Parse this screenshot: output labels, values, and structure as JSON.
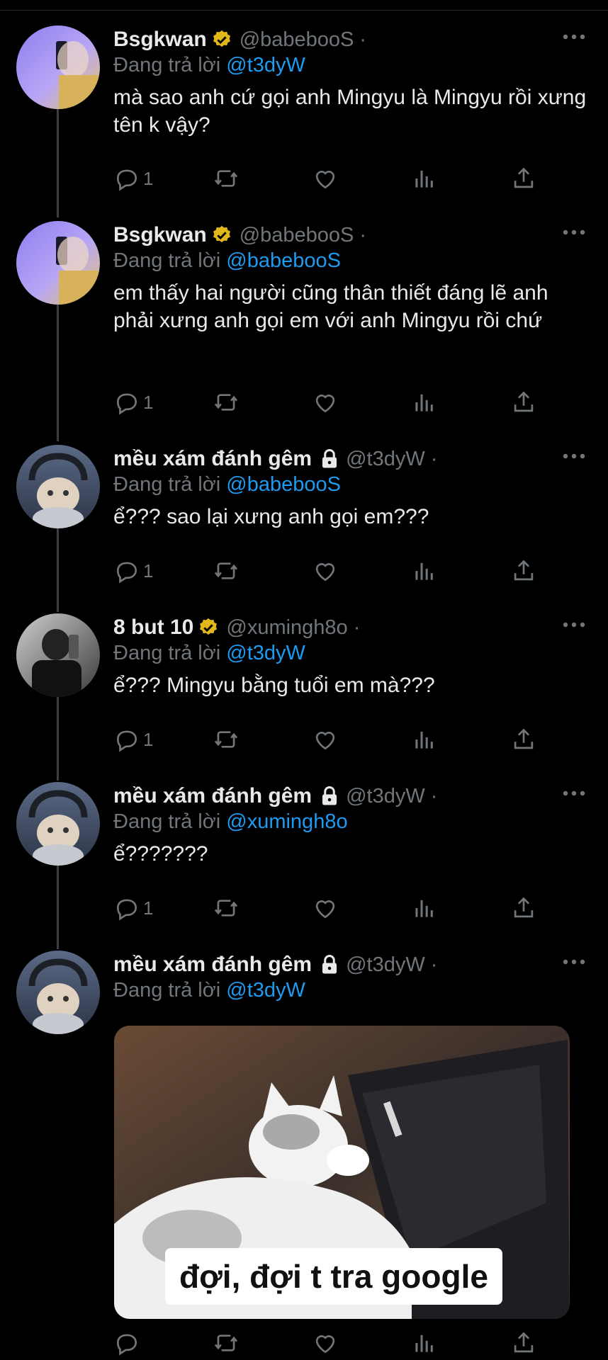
{
  "reply_prefix": "Đang trả lời",
  "tweets": [
    {
      "name": "Bsgkwan",
      "handle": "@babebooS",
      "dot": "·",
      "reply_to": "@t3dyW",
      "text": "mà sao anh cứ gọi anh Mingyu là Mingyu rồi xưng tên k vậy?",
      "reply_count": "1"
    },
    {
      "name": "Bsgkwan",
      "handle": "@babebooS",
      "dot": "·",
      "reply_to": "@babebooS",
      "text": "em thấy hai người cũng thân thiết đáng lẽ anh phải xưng anh gọi em với anh Mingyu rồi chứ",
      "reply_count": "1"
    },
    {
      "name": "mều xám đánh gêm",
      "handle": "@t3dyW",
      "dot": "·",
      "reply_to": "@babebooS",
      "text": "ể??? sao lại xưng anh gọi em???",
      "reply_count": "1"
    },
    {
      "name": "8 but 10",
      "handle": "@xumingh8o",
      "dot": "·",
      "reply_to": "@t3dyW",
      "text": "ể??? Mingyu bằng tuổi em mà???",
      "reply_count": "1"
    },
    {
      "name": "mều xám đánh gêm",
      "handle": "@t3dyW",
      "dot": "·",
      "reply_to": "@xumingh8o",
      "text": "ể???????",
      "reply_count": "1"
    },
    {
      "name": "mều xám đánh gêm",
      "handle": "@t3dyW",
      "dot": "·",
      "reply_to": "@t3dyW",
      "text": "",
      "reply_count": "",
      "media_caption": "đợi, đợi t tra google"
    }
  ],
  "icons": {
    "reply": "reply-icon",
    "retweet": "retweet-icon",
    "like": "like-icon",
    "views": "views-icon",
    "share": "share-icon",
    "verified": "verified-badge-icon",
    "lock": "lock-icon",
    "more": "more-icon"
  },
  "colors": {
    "background": "#000000",
    "text": "#e7e9ea",
    "muted": "#71767b",
    "link": "#1d9bf0",
    "verified": "#e2b719"
  }
}
